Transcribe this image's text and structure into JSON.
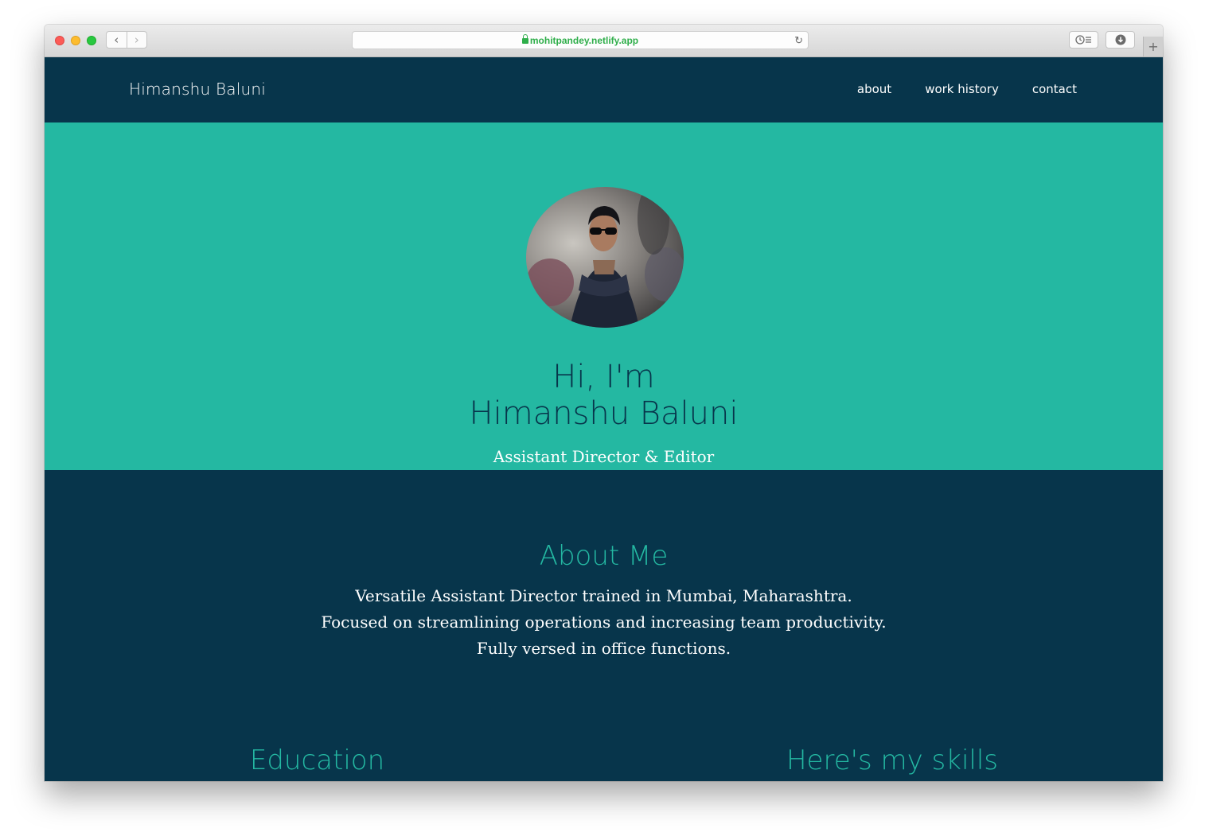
{
  "browser": {
    "url": "mohitpandey.netlify.app",
    "back_symbol": "‹",
    "forward_symbol": "›",
    "reload_symbol": "↻",
    "new_tab_symbol": "+",
    "icons": [
      "lock-icon",
      "reload-icon",
      "history-icon",
      "download-icon"
    ]
  },
  "nav": {
    "brand": "Himanshu Baluni",
    "links": [
      "about",
      "work history",
      "contact"
    ]
  },
  "hero": {
    "greeting": "Hi, I'm",
    "name": "Himanshu Baluni",
    "role": "Assistant Director & Editor"
  },
  "about": {
    "title": "About Me",
    "lines": [
      "Versatile Assistant Director trained in Mumbai, Maharashtra.",
      "Focused on streamlining operations and increasing team productivity.",
      "Fully versed in office functions."
    ]
  },
  "sections": {
    "education_title": "Education",
    "skills_title": "Here's my skills"
  },
  "colors": {
    "navy": "#07354b",
    "teal": "#24b8a2",
    "white": "#ffffff"
  }
}
